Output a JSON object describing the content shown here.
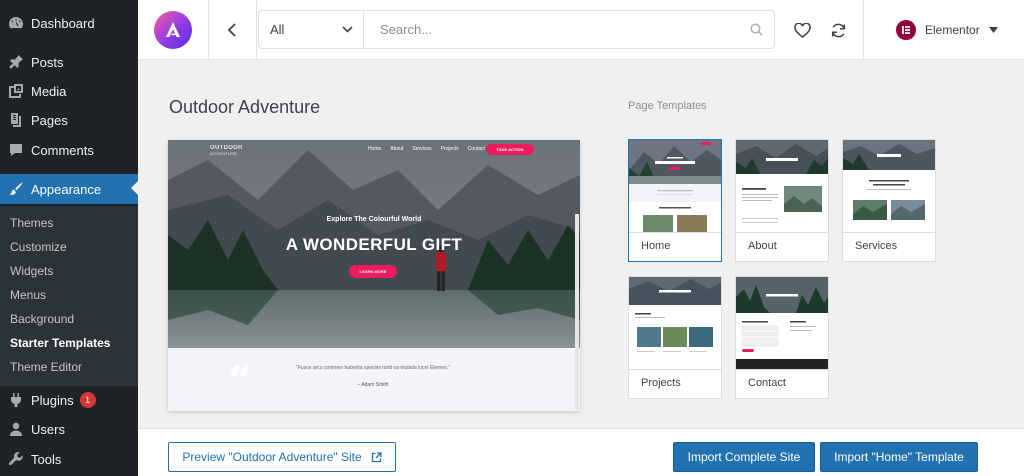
{
  "sidebar": {
    "items": [
      {
        "label": "Dashboard",
        "icon": "dashboard-icon"
      },
      {
        "label": "Posts",
        "icon": "pin-icon"
      },
      {
        "label": "Media",
        "icon": "media-icon"
      },
      {
        "label": "Pages",
        "icon": "pages-icon"
      },
      {
        "label": "Comments",
        "icon": "comment-icon"
      },
      {
        "label": "Appearance",
        "icon": "paintbrush-icon"
      },
      {
        "label": "Plugins",
        "icon": "plugin-icon",
        "badge": "1"
      },
      {
        "label": "Users",
        "icon": "users-icon"
      },
      {
        "label": "Tools",
        "icon": "wrench-icon"
      }
    ],
    "submenu": [
      "Themes",
      "Customize",
      "Widgets",
      "Menus",
      "Background",
      "Starter Templates",
      "Theme Editor"
    ]
  },
  "topbar": {
    "filter": {
      "value": "All"
    },
    "search": {
      "placeholder": "Search..."
    },
    "builder": {
      "label": "Elementor"
    }
  },
  "main": {
    "site_title": "Outdoor Adventure",
    "templates_label": "Page Templates",
    "preview": {
      "brand": "OUTDOOR",
      "brand_sub": "ADVENTURE",
      "nav": [
        "Home",
        "About",
        "Services",
        "Projects",
        "Contact"
      ],
      "cta": "TAKE ACTION",
      "eyebrow": "Explore The Colourful World",
      "title": "A WONDERFUL GIFT",
      "button": "LEARN MORE",
      "quote": "“Fusce arcu commen habenta species tordi oa mulada locel Elemen.”",
      "author": "– Adam Smith"
    },
    "cards": [
      {
        "label": "Home",
        "selected": true
      },
      {
        "label": "About",
        "selected": false
      },
      {
        "label": "Services",
        "selected": false
      },
      {
        "label": "Projects",
        "selected": false
      },
      {
        "label": "Contact",
        "selected": false
      }
    ]
  },
  "footer": {
    "preview_button": "Preview \"Outdoor Adventure\" Site",
    "import_site": "Import Complete Site",
    "import_template": "Import \"Home\" Template"
  },
  "colors": {
    "wp_sidebar": "#1d2327",
    "wp_active": "#2271b1",
    "accent_pink": "#ec1c5d",
    "elementor": "#92003b"
  }
}
